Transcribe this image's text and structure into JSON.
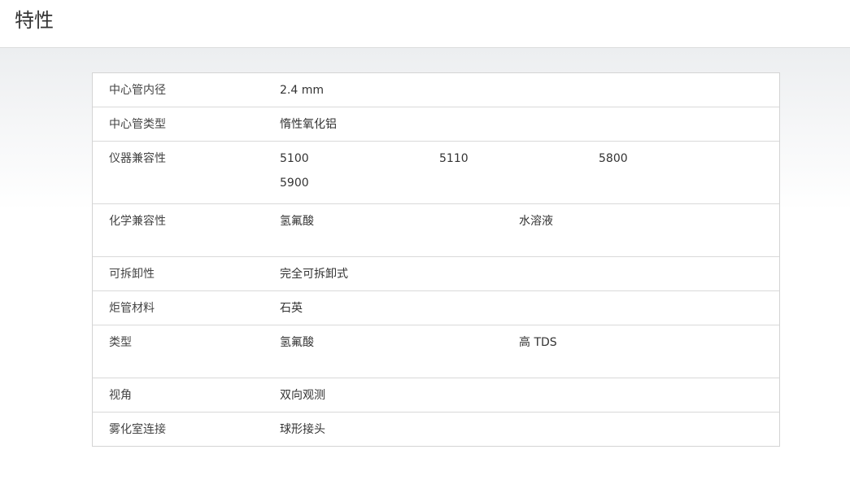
{
  "page": {
    "title": "特性"
  },
  "specs": [
    {
      "label": "中心管内径",
      "values": [
        "2.4 mm"
      ]
    },
    {
      "label": "中心管类型",
      "values": [
        "惰性氧化铝"
      ]
    },
    {
      "label": "仪器兼容性",
      "values": [
        "5100",
        "5110",
        "5800",
        "5900"
      ]
    },
    {
      "label": "化学兼容性",
      "values": [
        "氢氟酸",
        "水溶液"
      ]
    },
    {
      "label": "可拆卸性",
      "values": [
        "完全可拆卸式"
      ]
    },
    {
      "label": "炬管材料",
      "values": [
        "石英"
      ]
    },
    {
      "label": "类型",
      "values": [
        "氢氟酸",
        "高 TDS"
      ]
    },
    {
      "label": "视角",
      "values": [
        "双向观测"
      ]
    },
    {
      "label": "雾化室连接",
      "values": [
        "球形接头"
      ]
    }
  ]
}
